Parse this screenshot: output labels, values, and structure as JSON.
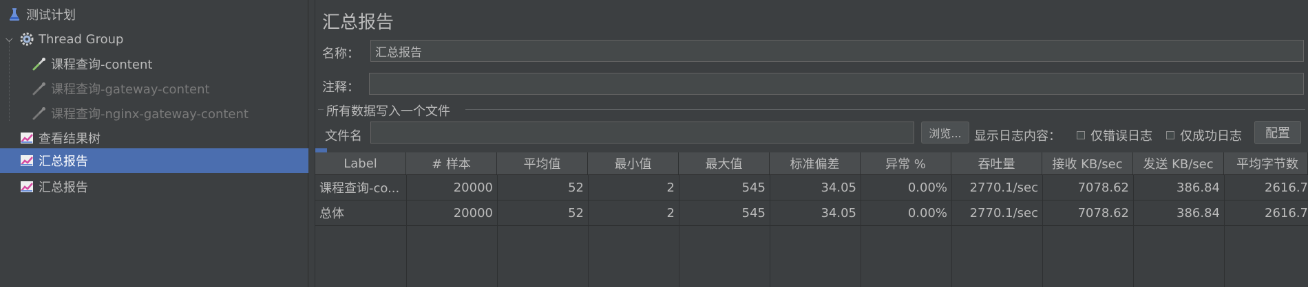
{
  "tree": {
    "items": [
      {
        "label": "测试计划",
        "icon": "test-plan-flask-icon"
      },
      {
        "label": "Thread Group",
        "icon": "gear-icon"
      },
      {
        "label": "课程查询-content",
        "icon": "http-sampler-pipette-icon"
      },
      {
        "label": "课程查询-gateway-content",
        "icon": "http-sampler-pipette-icon"
      },
      {
        "label": "课程查询-nginx-gateway-content",
        "icon": "http-sampler-pipette-icon"
      },
      {
        "label": "查看结果树",
        "icon": "listener-chart-icon"
      },
      {
        "label": "汇总报告",
        "icon": "listener-chart-icon"
      },
      {
        "label": "汇总报告",
        "icon": "listener-chart-icon"
      }
    ]
  },
  "panel": {
    "title": "汇总报告",
    "name_label": "名称：",
    "name_value": "汇总报告",
    "comment_label": "注释：",
    "comment_value": "",
    "file_section_label": "所有数据写入一个文件",
    "filename_label": "文件名",
    "filename_value": "",
    "browse_button": "浏览...",
    "log_display_label": "显示日志内容：",
    "errors_only_label": "仅错误日志",
    "success_only_label": "仅成功日志",
    "configure_button": "配置"
  },
  "table": {
    "headers": [
      "Label",
      "# 样本",
      "平均值",
      "最小值",
      "最大值",
      "标准偏差",
      "异常 %",
      "吞吐量",
      "接收 KB/sec",
      "发送 KB/sec",
      "平均字节数"
    ],
    "rows": [
      [
        "课程查询-co...",
        "20000",
        "52",
        "2",
        "545",
        "34.05",
        "0.00%",
        "2770.1/sec",
        "7078.62",
        "386.84",
        "2616.7"
      ],
      [
        "总体",
        "20000",
        "52",
        "2",
        "545",
        "34.05",
        "0.00%",
        "2770.1/sec",
        "7078.62",
        "386.84",
        "2616.7"
      ]
    ]
  },
  "colors": {
    "background": "#3c3f41",
    "selection": "#4b6eaf",
    "text": "#bbbbbb"
  }
}
